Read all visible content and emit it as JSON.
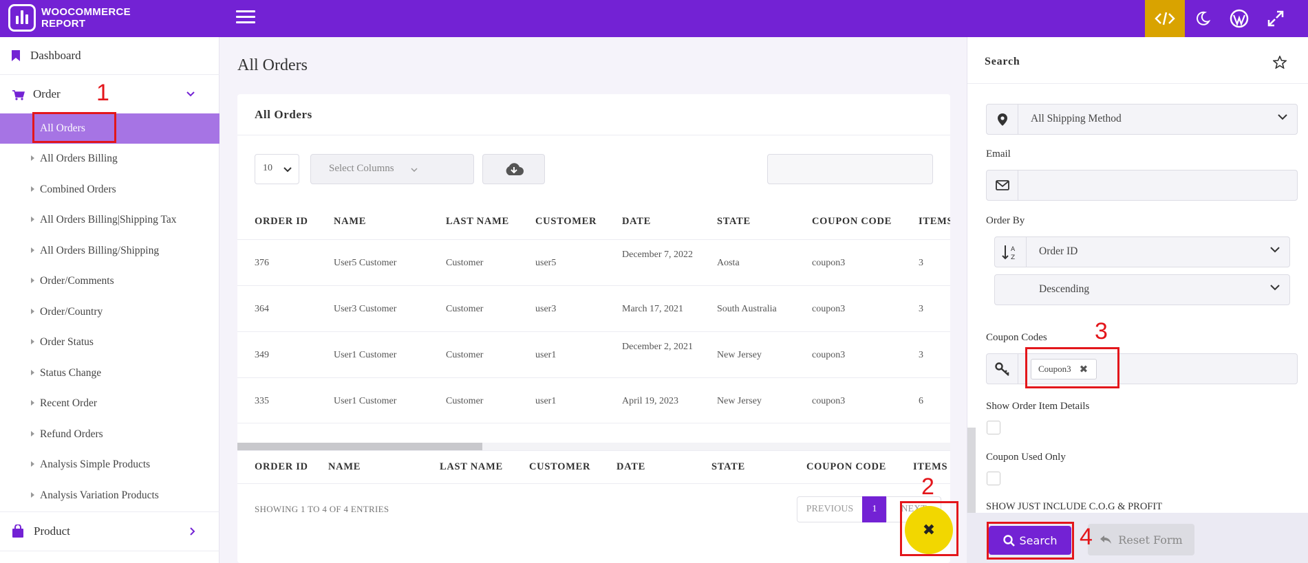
{
  "app": {
    "logo_line1": "WOOCOMMERCE",
    "logo_line2": "REPORT"
  },
  "sidebar": {
    "dashboard": "Dashboard",
    "order": "Order",
    "sub_items": [
      "All Orders",
      "All Orders Billing",
      "Combined Orders",
      "All Orders Billing|Shipping Tax",
      "All Orders Billing/Shipping",
      "Order/Comments",
      "Order/Country",
      "Order Status",
      "Status Change",
      "Recent Order",
      "Refund Orders",
      "Analysis Simple Products",
      "Analysis Variation Products"
    ],
    "product": "Product"
  },
  "main": {
    "page_title": "All Orders",
    "card_title": "All Orders",
    "page_length": "10",
    "select_columns_placeholder": "Select Columns",
    "columns": [
      "ORDER ID",
      "NAME",
      "LAST NAME",
      "CUSTOMER",
      "DATE",
      "STATE",
      "COUPON CODE",
      "ITEMS"
    ],
    "rows": [
      {
        "order_id": "376",
        "name": "User5 Customer",
        "last_name": "Customer",
        "customer": "user5",
        "date": "December 7, 2022",
        "state": "Aosta",
        "coupon": "coupon3",
        "items": "3"
      },
      {
        "order_id": "364",
        "name": "User3 Customer",
        "last_name": "Customer",
        "customer": "user3",
        "date": "March 17, 2021",
        "state": "South Australia",
        "coupon": "coupon3",
        "items": "3"
      },
      {
        "order_id": "349",
        "name": "User1 Customer",
        "last_name": "Customer",
        "customer": "user1",
        "date": "December 2, 2021",
        "state": "New Jersey",
        "coupon": "coupon3",
        "items": "3"
      },
      {
        "order_id": "335",
        "name": "User1 Customer",
        "last_name": "Customer",
        "customer": "user1",
        "date": "April 19, 2023",
        "state": "New Jersey",
        "coupon": "coupon3",
        "items": "6"
      }
    ],
    "entries_info": "SHOWING 1 TO 4 OF 4 ENTRIES",
    "pagination": {
      "previous": "PREVIOUS",
      "current": "1",
      "next": "NEXT"
    },
    "close_symbol": "✖"
  },
  "panel": {
    "title": "Search",
    "shipping_method": "All Shipping Method",
    "email_label": "Email",
    "email_value": "",
    "order_by_label": "Order By",
    "order_by_value": "Order ID",
    "order_direction": "Descending",
    "coupon_label": "Coupon Codes",
    "coupon_tag": "Coupon3",
    "coupon_tag_remove": "✖",
    "show_item_details_label": "Show Order Item Details",
    "coupon_used_only_label": "Coupon Used Only",
    "cog_label": "SHOW JUST INCLUDE C.O.G & PROFIT",
    "search_button": "Search",
    "reset_button": "Reset Form"
  },
  "annotations": [
    "1",
    "2",
    "3",
    "4"
  ],
  "colors": {
    "primary": "#7322d4",
    "accent": "#d9a300",
    "active_item": "#a674e4",
    "highlight": "#e3161b",
    "fab": "#f2d700"
  }
}
